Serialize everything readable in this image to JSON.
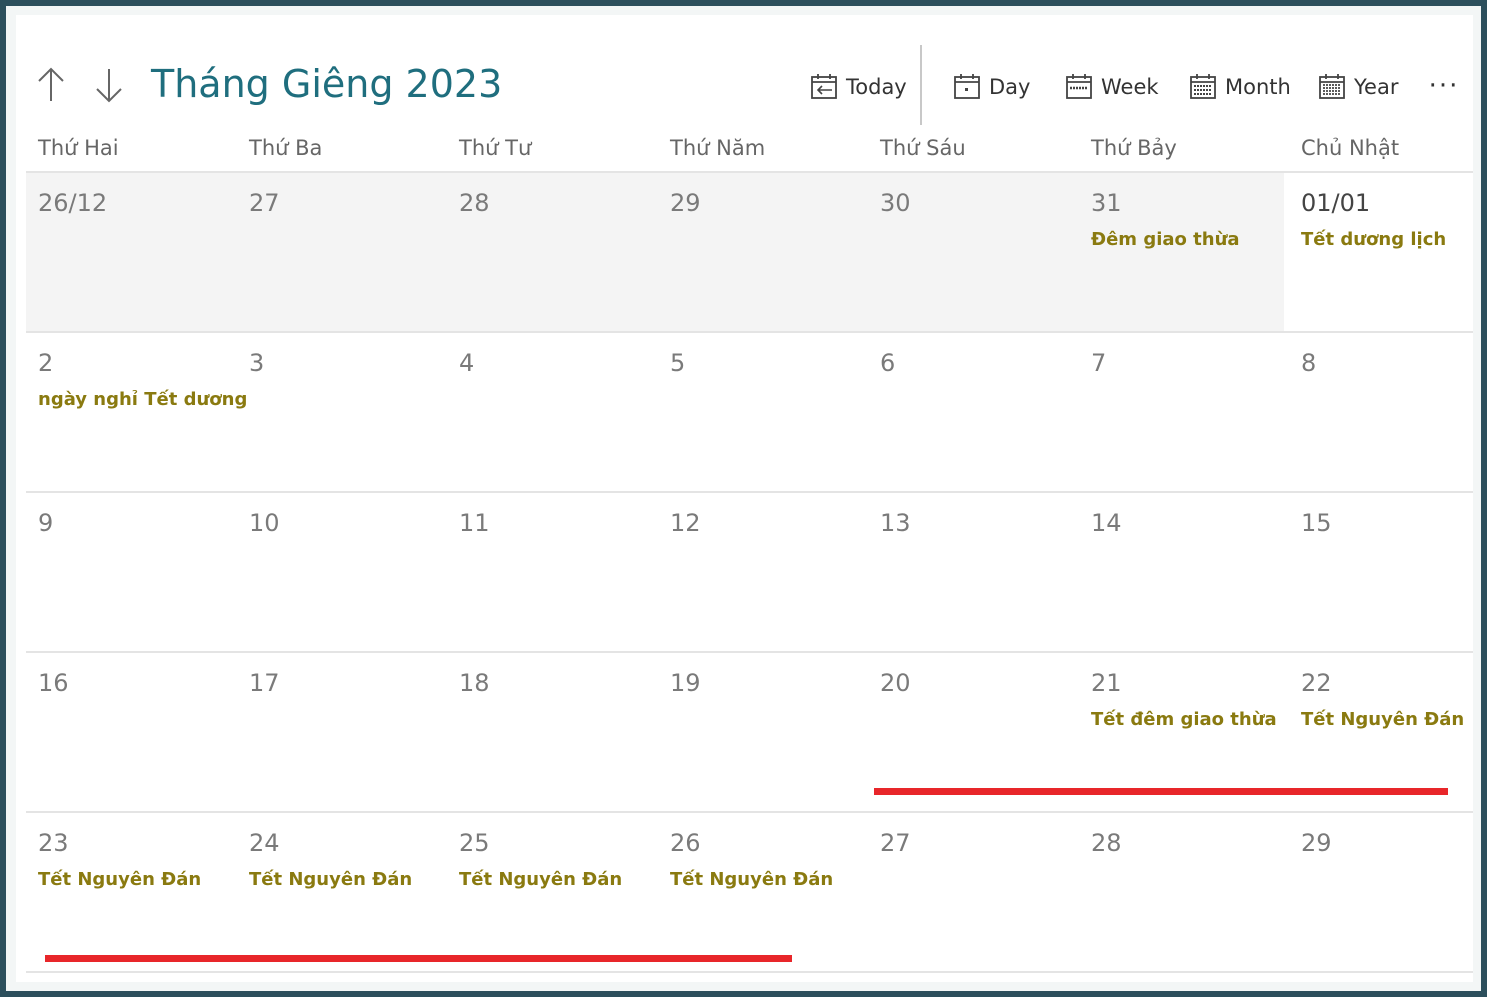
{
  "header": {
    "title": "Tháng Giêng 2023",
    "toolbar": {
      "today": "Today",
      "day": "Day",
      "week": "Week",
      "month": "Month",
      "year": "Year",
      "more": "···"
    }
  },
  "weekdays": [
    "Thứ Hai",
    "Thứ Ba",
    "Thứ Tư",
    "Thứ Năm",
    "Thứ Sáu",
    "Thứ Bảy",
    "Chủ Nhật"
  ],
  "weeks": [
    [
      {
        "day": "26/12",
        "event": ""
      },
      {
        "day": "27",
        "event": ""
      },
      {
        "day": "28",
        "event": ""
      },
      {
        "day": "29",
        "event": ""
      },
      {
        "day": "30",
        "event": ""
      },
      {
        "day": "31",
        "event": "Đêm giao thừa"
      },
      {
        "day": "01/01",
        "event": "Tết dương lịch"
      }
    ],
    [
      {
        "day": "2",
        "event": "ngày nghỉ Tết dương"
      },
      {
        "day": "3",
        "event": ""
      },
      {
        "day": "4",
        "event": ""
      },
      {
        "day": "5",
        "event": ""
      },
      {
        "day": "6",
        "event": ""
      },
      {
        "day": "7",
        "event": ""
      },
      {
        "day": "8",
        "event": ""
      }
    ],
    [
      {
        "day": "9",
        "event": ""
      },
      {
        "day": "10",
        "event": ""
      },
      {
        "day": "11",
        "event": ""
      },
      {
        "day": "12",
        "event": ""
      },
      {
        "day": "13",
        "event": ""
      },
      {
        "day": "14",
        "event": ""
      },
      {
        "day": "15",
        "event": ""
      }
    ],
    [
      {
        "day": "16",
        "event": ""
      },
      {
        "day": "17",
        "event": ""
      },
      {
        "day": "18",
        "event": ""
      },
      {
        "day": "19",
        "event": ""
      },
      {
        "day": "20",
        "event": ""
      },
      {
        "day": "21",
        "event": "Tết đêm giao thừa"
      },
      {
        "day": "22",
        "event": "Tết Nguyên Đán"
      }
    ],
    [
      {
        "day": "23",
        "event": "Tết Nguyên Đán"
      },
      {
        "day": "24",
        "event": "Tết Nguyên Đán"
      },
      {
        "day": "25",
        "event": "Tết Nguyên Đán"
      },
      {
        "day": "26",
        "event": "Tết Nguyên Đán"
      },
      {
        "day": "27",
        "event": ""
      },
      {
        "day": "28",
        "event": ""
      },
      {
        "day": "29",
        "event": ""
      }
    ]
  ],
  "colors": {
    "title": "#1f6e7e",
    "event": "#8a7a10",
    "highlight": "#e8262a",
    "frame": "#2c4f5c"
  }
}
